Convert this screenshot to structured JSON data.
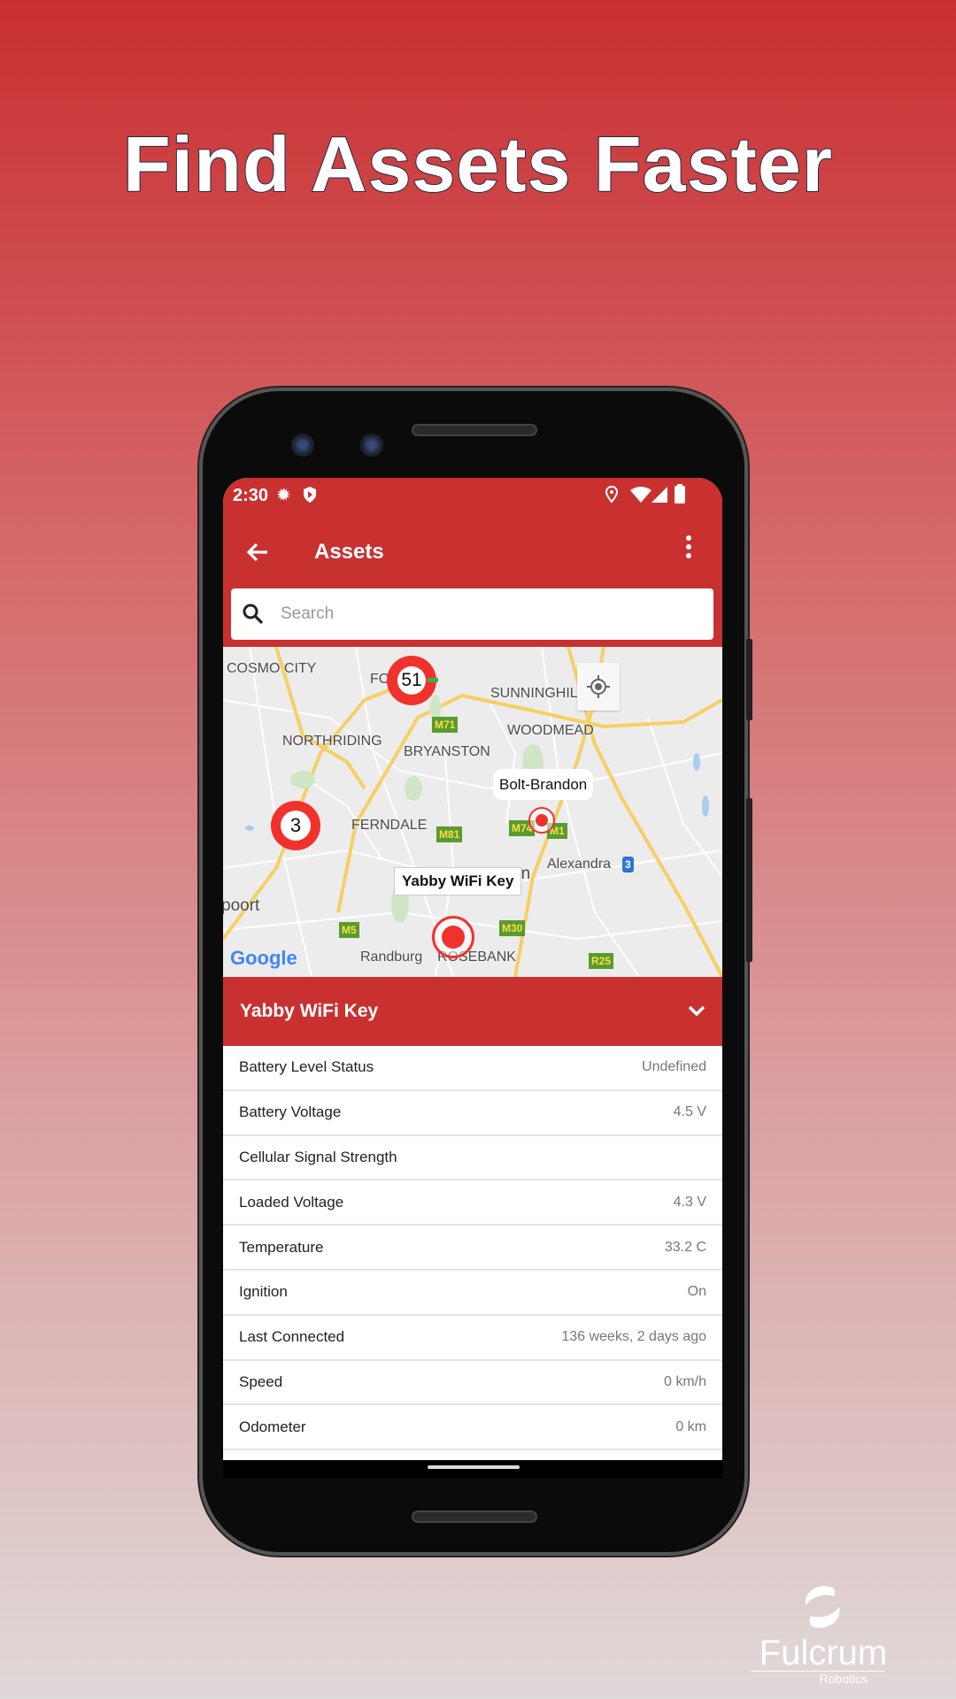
{
  "headline": "Find Assets Faster",
  "status_bar": {
    "time": "2:30",
    "icons": [
      "gear-icon",
      "shield-play-icon",
      "location-icon",
      "wifi-icon",
      "signal-icon",
      "battery-icon"
    ]
  },
  "app_bar": {
    "title": "Assets",
    "back_icon": "arrow-left-icon",
    "menu_icon": "more-vert-icon"
  },
  "search": {
    "placeholder": "Search",
    "value": ""
  },
  "map": {
    "labels": {
      "cosmo_city": "COSMO CITY",
      "four": "FOUR",
      "sunninghill": "SUNNINGHILL",
      "northriding": "NORTHRIDING",
      "bryanston": "BRYANSTON",
      "woodmead": "WOODMEAD",
      "ferndale": "FERNDALE",
      "alexandra": "Alexandra",
      "on": "on",
      "poort": "poort",
      "randburg": "Randburg",
      "rosebank": "ROSEBANK"
    },
    "shields": {
      "m71": "M71",
      "m81": "M81",
      "m74": "M74",
      "m1": "M1",
      "m5": "M5",
      "m30": "M30",
      "r25": "R25",
      "n3": "3"
    },
    "clusters": [
      {
        "count": "51"
      },
      {
        "count": "3"
      }
    ],
    "markers": [
      {
        "label": "Bolt-Brandon"
      },
      {
        "label": "Yabby WiFi Key"
      }
    ],
    "attribution": "Google",
    "accent": "#c93131",
    "marker_color": "#f0322d"
  },
  "detail": {
    "title": "Yabby WiFi Key",
    "rows": [
      {
        "label": "Battery Level Status",
        "value": "Undefined"
      },
      {
        "label": "Battery Voltage",
        "value": "4.5 V"
      },
      {
        "label": "Cellular Signal Strength",
        "value": ""
      },
      {
        "label": "Loaded Voltage",
        "value": "4.3 V"
      },
      {
        "label": "Temperature",
        "value": "33.2 C"
      },
      {
        "label": "Ignition",
        "value": "On"
      },
      {
        "label": "Last Connected",
        "value": "136 weeks, 2 days ago"
      },
      {
        "label": "Speed",
        "value": "0 km/h"
      },
      {
        "label": "Odometer",
        "value": "0 km"
      }
    ]
  },
  "logo": {
    "name": "Fulcrum",
    "sub": "Robotics"
  }
}
